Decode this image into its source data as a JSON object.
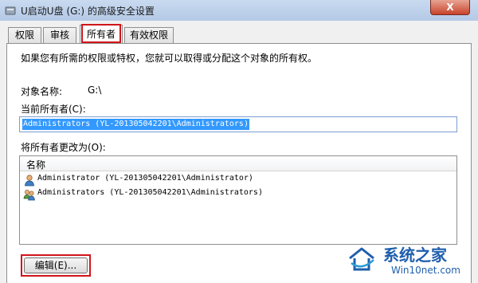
{
  "window": {
    "title": "U启动U盘 (G:) 的高级安全设置",
    "close_label": "X"
  },
  "tabs": [
    {
      "label": "权限"
    },
    {
      "label": "审核"
    },
    {
      "label": "所有者"
    },
    {
      "label": "有效权限"
    }
  ],
  "active_tab": "所有者",
  "owner": {
    "info_text": "如果您有所需的权限或特权，您就可以取得或分配这个对象的所有权。",
    "object_name_label": "对象名称:",
    "object_name_value": "G:\\",
    "current_owner_label": "当前所有者(C):",
    "current_owner_value": "Administrators (YL-201305042201\\Administrators)",
    "change_owner_label": "将所有者更改为(O):",
    "list_header": "名称",
    "list_items": [
      {
        "label": "Administrator (YL-201305042201\\Administrator)",
        "icon": "user-icon"
      },
      {
        "label": "Administrators (YL-201305042201\\Administrators)",
        "icon": "user-group-icon"
      }
    ],
    "edit_button_label": "编辑(E)..."
  },
  "watermark": {
    "brand_text": "系统之家",
    "site_text": "Win10net.com"
  },
  "colors": {
    "highlight_red": "#d0151b",
    "selection_blue": "#3399ff",
    "watermark_blue": "#1f5fae"
  }
}
